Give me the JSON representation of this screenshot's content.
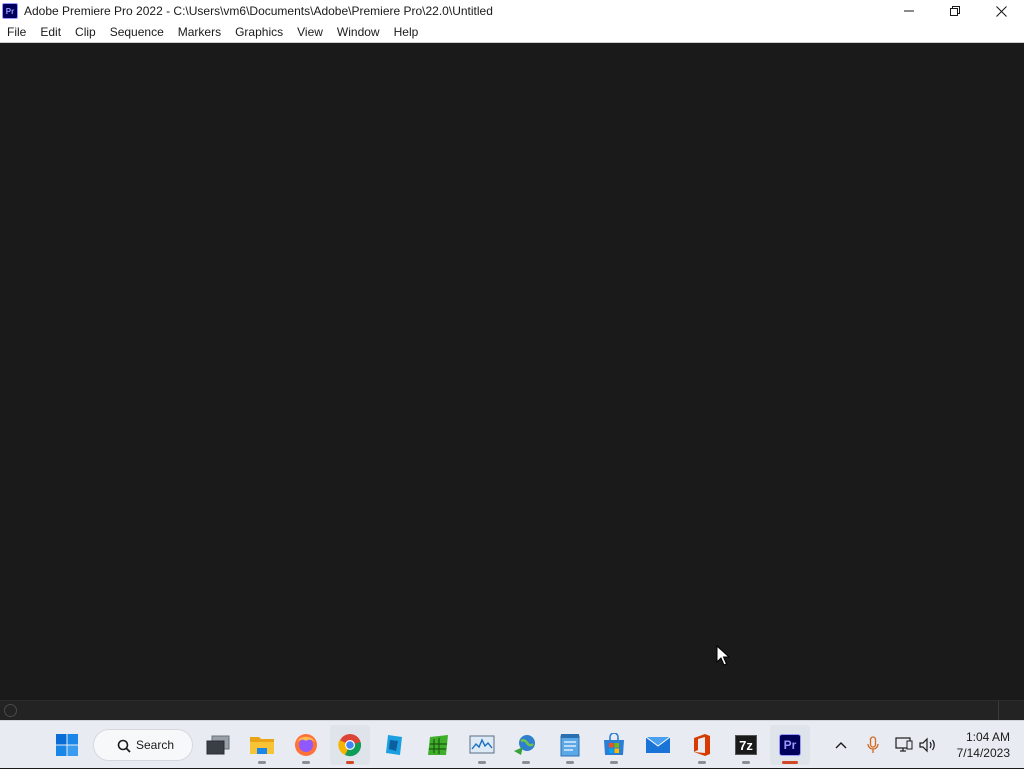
{
  "window": {
    "title": "Adobe Premiere Pro 2022 - C:\\Users\\vm6\\Documents\\Adobe\\Premiere Pro\\22.0\\Untitled",
    "app_icon_text": "Pr"
  },
  "menu": {
    "items": [
      {
        "label": "File"
      },
      {
        "label": "Edit"
      },
      {
        "label": "Clip"
      },
      {
        "label": "Sequence"
      },
      {
        "label": "Markers"
      },
      {
        "label": "Graphics"
      },
      {
        "label": "View"
      },
      {
        "label": "Window"
      },
      {
        "label": "Help"
      }
    ]
  },
  "taskbar": {
    "search_label": "Search",
    "apps": [
      {
        "name": "start-icon"
      },
      {
        "name": "task-view-icon"
      },
      {
        "name": "file-explorer-icon"
      },
      {
        "name": "firefox-icon"
      },
      {
        "name": "chrome-icon"
      },
      {
        "name": "app-blue-icon"
      },
      {
        "name": "spreadsheet-icon"
      },
      {
        "name": "resource-monitor-icon"
      },
      {
        "name": "network-globe-icon"
      },
      {
        "name": "notepad-icon"
      },
      {
        "name": "microsoft-store-icon"
      },
      {
        "name": "mail-icon"
      },
      {
        "name": "office-icon"
      },
      {
        "name": "7zip-icon"
      },
      {
        "name": "premiere-pro-icon"
      }
    ],
    "sevenzip_text": "7z",
    "premiere_text": "Pr",
    "clock": {
      "time": "1:04 AM",
      "date": "7/14/2023"
    }
  },
  "colors": {
    "workspace_bg": "#1a1a1a",
    "premiere_brand": "#9999ff",
    "premiere_bg": "#00005b",
    "taskbar_bg": "#e8ecf2"
  }
}
